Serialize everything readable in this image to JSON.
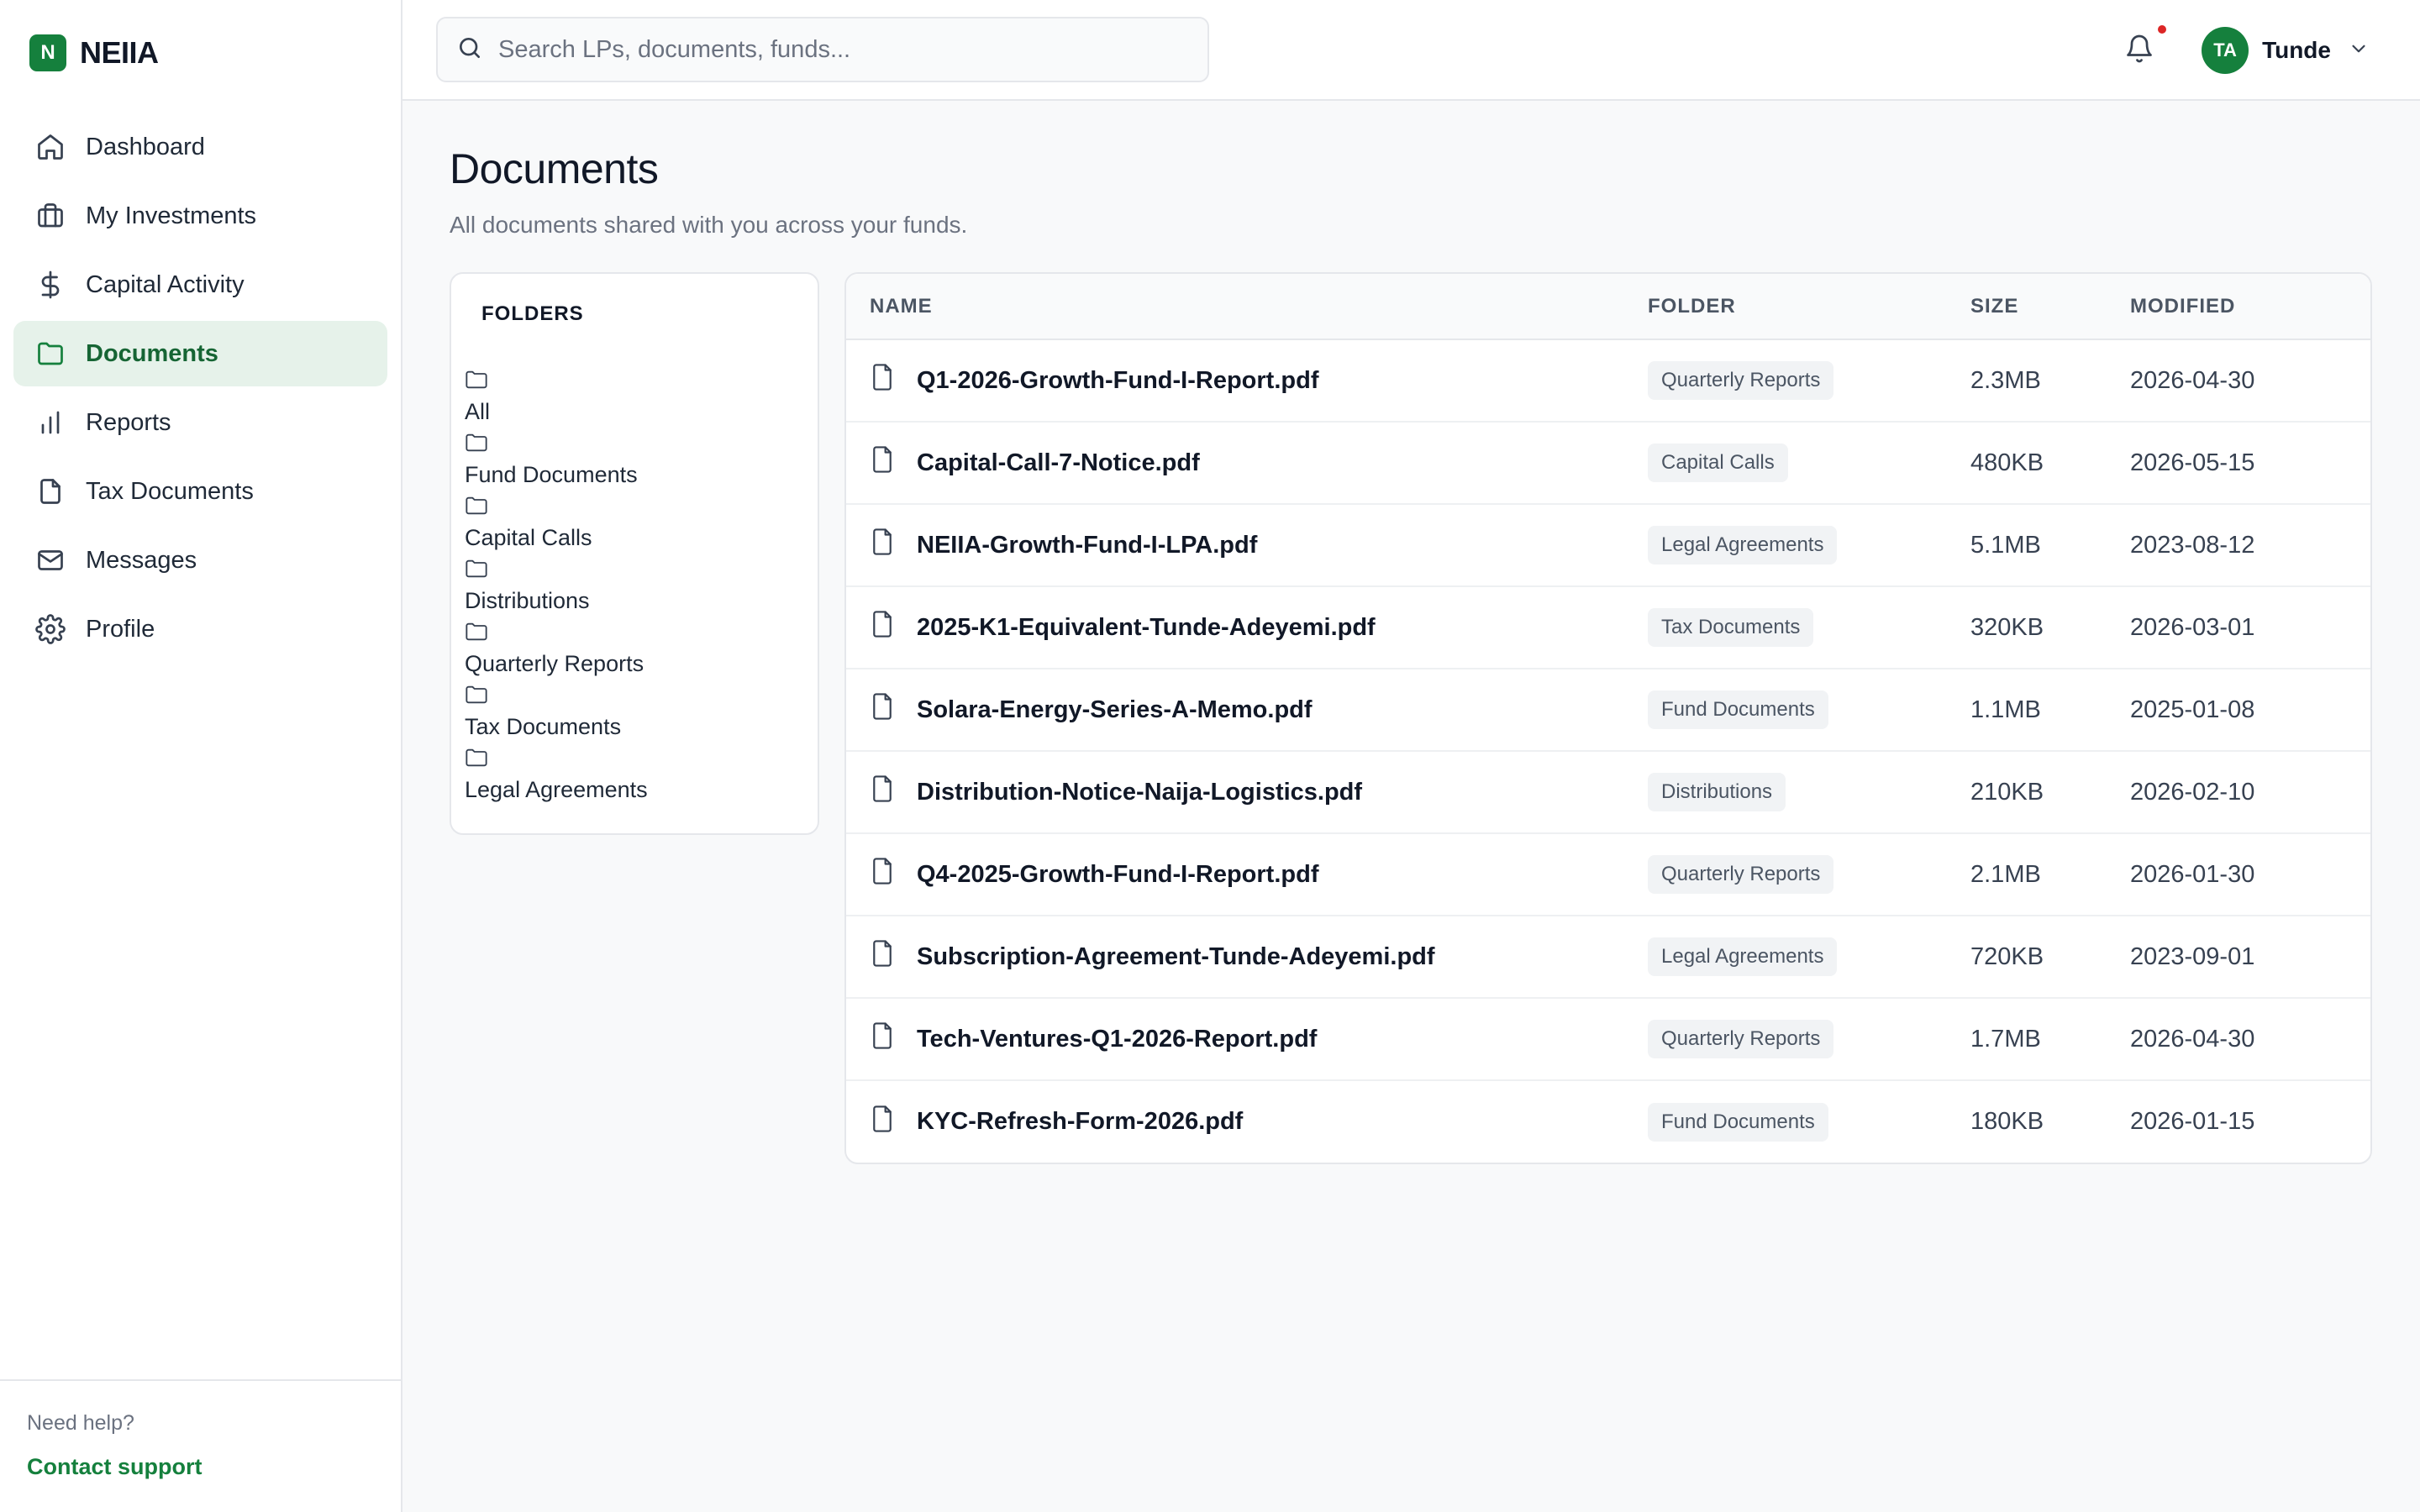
{
  "brand": {
    "logo_letter": "N",
    "name": "NEIIA"
  },
  "sidebar": {
    "items": [
      {
        "label": "Dashboard",
        "icon": "home-icon",
        "active": false
      },
      {
        "label": "My Investments",
        "icon": "briefcase-icon",
        "active": false
      },
      {
        "label": "Capital Activity",
        "icon": "dollar-icon",
        "active": false
      },
      {
        "label": "Documents",
        "icon": "folder-icon",
        "active": true
      },
      {
        "label": "Reports",
        "icon": "bar-chart-icon",
        "active": false
      },
      {
        "label": "Tax Documents",
        "icon": "file-icon",
        "active": false
      },
      {
        "label": "Messages",
        "icon": "mail-icon",
        "active": false
      },
      {
        "label": "Profile",
        "icon": "gear-icon",
        "active": false
      }
    ],
    "help_text": "Need help?",
    "support_link": "Contact support"
  },
  "topbar": {
    "search_placeholder": "Search LPs, documents, funds...",
    "search_value": "",
    "user_initials": "TA",
    "user_name": "Tunde",
    "has_notification": true
  },
  "page": {
    "title": "Documents",
    "subtitle": "All documents shared with you across your funds."
  },
  "folders": {
    "title": "FOLDERS",
    "items": [
      "All",
      "Fund Documents",
      "Capital Calls",
      "Distributions",
      "Quarterly Reports",
      "Tax Documents",
      "Legal Agreements"
    ]
  },
  "table": {
    "headers": {
      "name": "NAME",
      "folder": "FOLDER",
      "size": "SIZE",
      "modified": "MODIFIED"
    },
    "rows": [
      {
        "name": "Q1-2026-Growth-Fund-I-Report.pdf",
        "folder": "Quarterly Reports",
        "size": "2.3MB",
        "modified": "2026-04-30"
      },
      {
        "name": "Capital-Call-7-Notice.pdf",
        "folder": "Capital Calls",
        "size": "480KB",
        "modified": "2026-05-15"
      },
      {
        "name": "NEIIA-Growth-Fund-I-LPA.pdf",
        "folder": "Legal Agreements",
        "size": "5.1MB",
        "modified": "2023-08-12"
      },
      {
        "name": "2025-K1-Equivalent-Tunde-Adeyemi.pdf",
        "folder": "Tax Documents",
        "size": "320KB",
        "modified": "2026-03-01"
      },
      {
        "name": "Solara-Energy-Series-A-Memo.pdf",
        "folder": "Fund Documents",
        "size": "1.1MB",
        "modified": "2025-01-08"
      },
      {
        "name": "Distribution-Notice-Naija-Logistics.pdf",
        "folder": "Distributions",
        "size": "210KB",
        "modified": "2026-02-10"
      },
      {
        "name": "Q4-2025-Growth-Fund-I-Report.pdf",
        "folder": "Quarterly Reports",
        "size": "2.1MB",
        "modified": "2026-01-30"
      },
      {
        "name": "Subscription-Agreement-Tunde-Adeyemi.pdf",
        "folder": "Legal Agreements",
        "size": "720KB",
        "modified": "2023-09-01"
      },
      {
        "name": "Tech-Ventures-Q1-2026-Report.pdf",
        "folder": "Quarterly Reports",
        "size": "1.7MB",
        "modified": "2026-04-30"
      },
      {
        "name": "KYC-Refresh-Form-2026.pdf",
        "folder": "Fund Documents",
        "size": "180KB",
        "modified": "2026-01-15"
      }
    ]
  },
  "colors": {
    "accent": "#15803d",
    "accent_bg": "#e6f2ea",
    "notification_dot": "#dc2626"
  }
}
